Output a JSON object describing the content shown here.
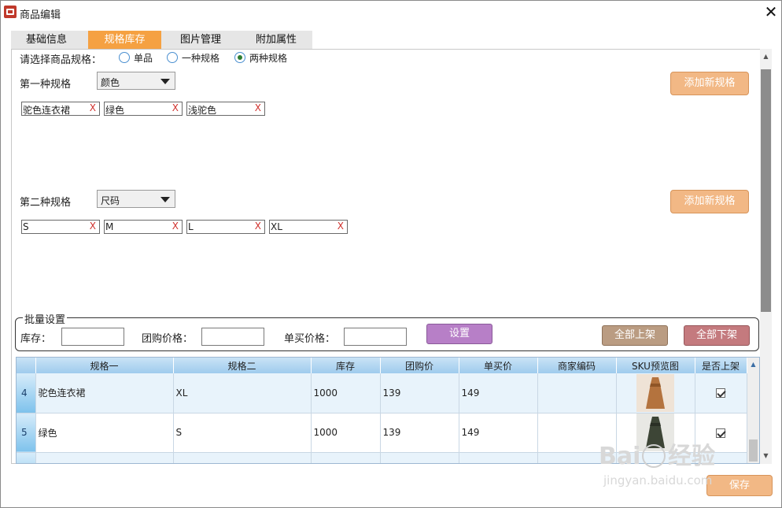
{
  "window": {
    "title": "商品编辑"
  },
  "tabs": [
    {
      "label": "基础信息",
      "active": false
    },
    {
      "label": "规格库存",
      "active": true
    },
    {
      "label": "图片管理",
      "active": false
    },
    {
      "label": "附加属性",
      "active": false
    }
  ],
  "spec_type": {
    "label": "请选择商品规格：",
    "options": [
      {
        "label": "单品",
        "checked": false
      },
      {
        "label": "一种规格",
        "checked": false
      },
      {
        "label": "两种规格",
        "checked": true
      }
    ]
  },
  "spec1": {
    "label": "第一种规格",
    "selected": "颜色",
    "values": [
      "驼色连衣裙",
      "绿色",
      "浅驼色"
    ],
    "add_button": "添加新规格"
  },
  "spec2": {
    "label": "第二种规格",
    "selected": "尺码",
    "values": [
      "S",
      "M",
      "L",
      "XL"
    ],
    "add_button": "添加新规格"
  },
  "chip_delete_glyph": "X",
  "batch": {
    "title": "批量设置",
    "stock_label": "库存：",
    "group_price_label": "团购价格：",
    "single_price_label": "单买价格：",
    "stock_value": "",
    "group_price_value": "",
    "single_price_value": "",
    "set_button": "设置",
    "all_on_button": "全部上架",
    "all_off_button": "全部下架"
  },
  "grid": {
    "columns": [
      "规格一",
      "规格二",
      "库存",
      "团购价",
      "单买价",
      "商家编码",
      "SKU预览图",
      "是否上架"
    ],
    "rows": [
      {
        "num": "4",
        "spec1": "驼色连衣裙",
        "spec2": "XL",
        "stock": "1000",
        "group_price": "139",
        "single_price": "149",
        "merchant_code": "",
        "listed": true,
        "preview": "camel-dress"
      },
      {
        "num": "5",
        "spec1": "绿色",
        "spec2": "S",
        "stock": "1000",
        "group_price": "139",
        "single_price": "149",
        "merchant_code": "",
        "listed": true,
        "preview": "green-dress"
      }
    ]
  },
  "save_button": "保存",
  "watermark": {
    "brand": "Baidu经验",
    "url": "jingyan.baidu.com"
  },
  "colors": {
    "accent_orange": "#f5a142",
    "button_orange": "#f2b885",
    "chip_delete": "#d0312d"
  }
}
